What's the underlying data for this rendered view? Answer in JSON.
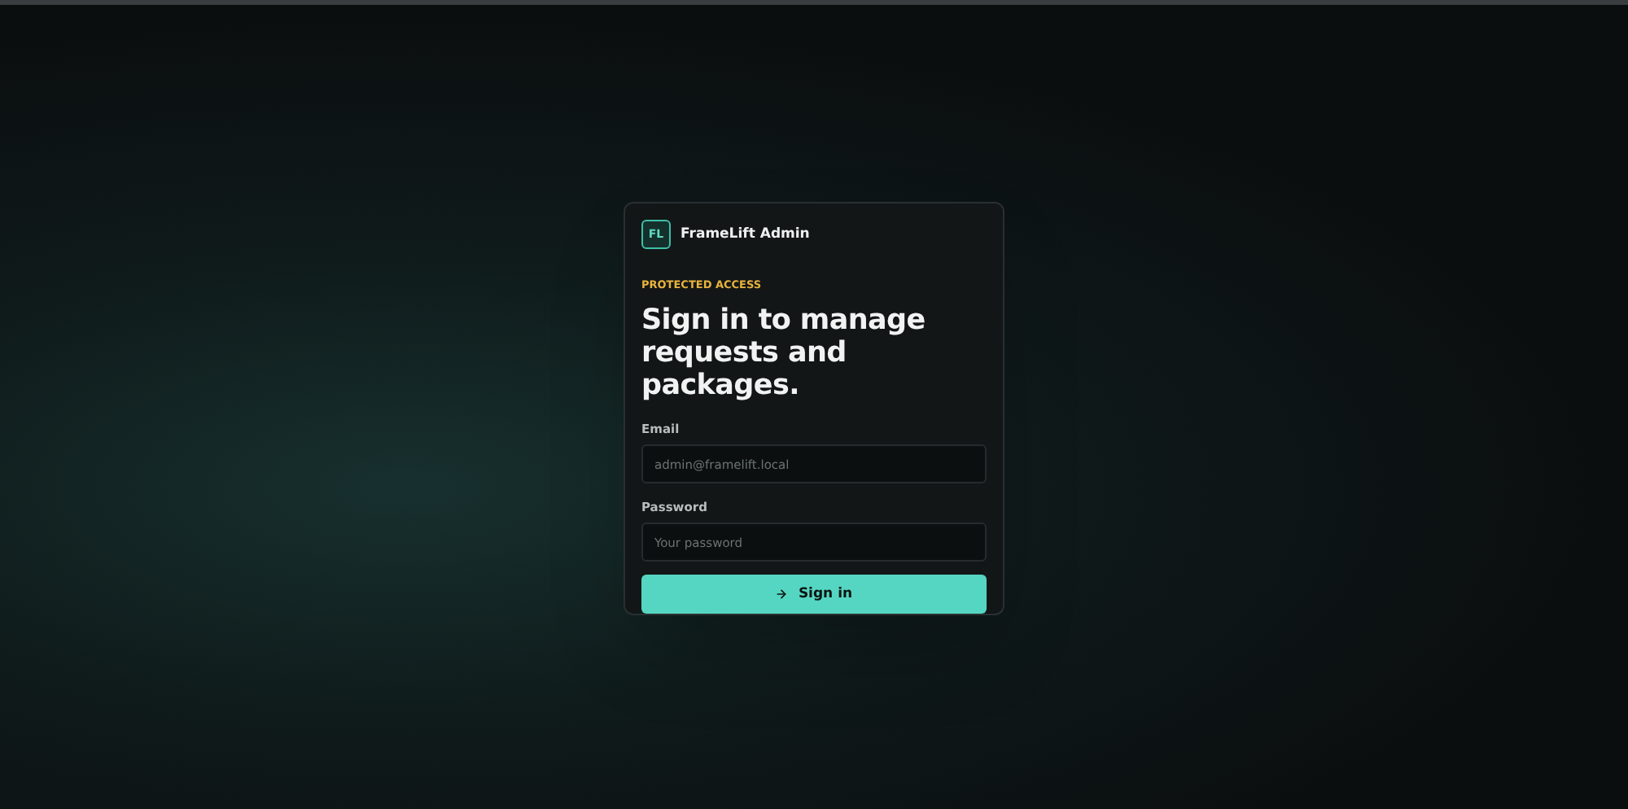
{
  "brand": {
    "logo": "FL",
    "name": "FrameLift Admin"
  },
  "eyebrow": "PROTECTED ACCESS",
  "heading": "Sign in to manage requests and packages.",
  "fields": [
    {
      "label": "Email",
      "placeholder": "admin@framelift.local"
    },
    {
      "label": "Password",
      "placeholder": "Your password"
    }
  ],
  "submit": {
    "label": "Sign in"
  }
}
